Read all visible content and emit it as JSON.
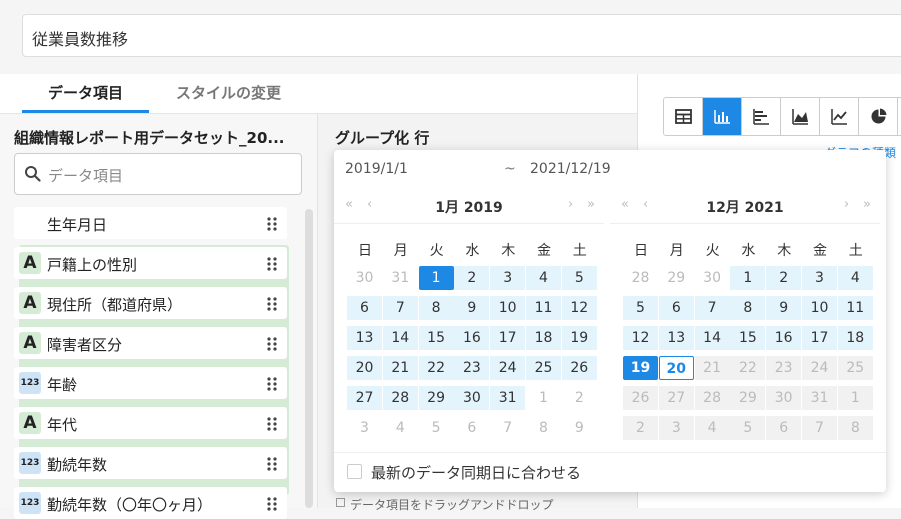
{
  "header": {
    "title_value": "従業員数推移"
  },
  "tabs": [
    {
      "label": "データ項目"
    },
    {
      "label": "スタイルの変更"
    }
  ],
  "left": {
    "dataset_title": "組織情報レポート用データセット_20...",
    "search_placeholder": "データ項目",
    "fields": [
      {
        "type": "date",
        "label": "生年月日"
      },
      {
        "type": "text",
        "label": "戸籍上の性別"
      },
      {
        "type": "text",
        "label": "現住所（都道府県）"
      },
      {
        "type": "text",
        "label": "障害者区分"
      },
      {
        "type": "number",
        "label": "年齢"
      },
      {
        "type": "text",
        "label": "年代"
      },
      {
        "type": "number",
        "label": "勤続年数"
      },
      {
        "type": "number",
        "label": "勤続年数（〇年〇ヶ月）"
      }
    ],
    "text_icon_glyph": "A",
    "number_icon_glyph": "123"
  },
  "middle": {
    "group_title": "グループ化 行",
    "hint": "データ項目をドラッグアンドドロップ"
  },
  "right": {
    "chart_types": [
      "table-icon",
      "bar-chart-icon",
      "horizontal-bar-icon",
      "area-chart-icon",
      "line-chart-icon",
      "pie-chart-icon"
    ],
    "active_index": 1,
    "chart_link": "グラフの種類"
  },
  "datepicker": {
    "start": "2019/1/1",
    "separator": "~",
    "end": "2021/12/19",
    "weekdays": [
      "日",
      "月",
      "火",
      "水",
      "木",
      "金",
      "土"
    ],
    "left_month": "1月 2019",
    "right_month": "12月 2021",
    "left_days": [
      [
        "30",
        "31",
        "1",
        "2",
        "3",
        "4",
        "5"
      ],
      [
        "6",
        "7",
        "8",
        "9",
        "10",
        "11",
        "12"
      ],
      [
        "13",
        "14",
        "15",
        "16",
        "17",
        "18",
        "19"
      ],
      [
        "20",
        "21",
        "22",
        "23",
        "24",
        "25",
        "26"
      ],
      [
        "27",
        "28",
        "29",
        "30",
        "31",
        "1",
        "2"
      ],
      [
        "3",
        "4",
        "5",
        "6",
        "7",
        "8",
        "9"
      ]
    ],
    "right_days": [
      [
        "28",
        "29",
        "30",
        "1",
        "2",
        "3",
        "4"
      ],
      [
        "5",
        "6",
        "7",
        "8",
        "9",
        "10",
        "11"
      ],
      [
        "12",
        "13",
        "14",
        "15",
        "16",
        "17",
        "18"
      ],
      [
        "19",
        "20",
        "21",
        "22",
        "23",
        "24",
        "25"
      ],
      [
        "26",
        "27",
        "28",
        "29",
        "30",
        "31",
        "1"
      ],
      [
        "2",
        "3",
        "4",
        "5",
        "6",
        "7",
        "8"
      ]
    ],
    "footer_label": "最新のデータ同期日に合わせる",
    "colors": {
      "accent": "#1e88e5",
      "range": "#e3f4fd",
      "disabled": "#f1f1f1"
    }
  }
}
